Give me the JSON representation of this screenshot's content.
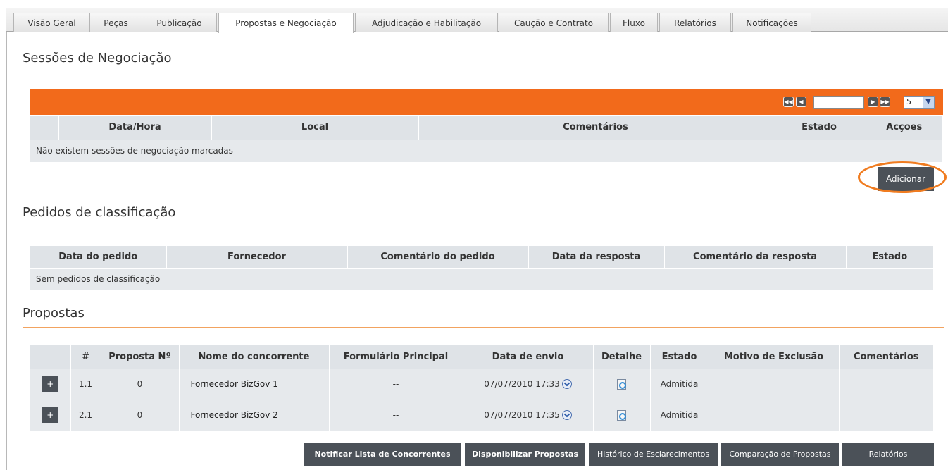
{
  "tabs": [
    {
      "label": "Visão Geral"
    },
    {
      "label": "Peças"
    },
    {
      "label": "Publicação"
    },
    {
      "label": "Propostas e Negociação"
    },
    {
      "label": "Adjudicação e Habilitação"
    },
    {
      "label": "Caução e Contrato"
    },
    {
      "label": "Fluxo"
    },
    {
      "label": "Relatórios"
    },
    {
      "label": "Notificações"
    }
  ],
  "active_tab": "Propostas e Negociação",
  "sessoes": {
    "title": "Sessões de Negociação",
    "pager": {
      "page_size": "5"
    },
    "headers": [
      "Data/Hora",
      "Local",
      "Comentários",
      "Estado",
      "Acções"
    ],
    "empty_message": "Não existem sessões de negociação marcadas",
    "add_button": "Adicionar"
  },
  "pedidos": {
    "title": "Pedidos de classificação",
    "headers": [
      "Data do pedido",
      "Fornecedor",
      "Comentário do pedido",
      "Data da resposta",
      "Comentário da resposta",
      "Estado"
    ],
    "empty_message": "Sem pedidos de classificação"
  },
  "propostas": {
    "title": "Propostas",
    "headers": [
      "#",
      "Proposta Nº",
      "Nome do concorrente",
      "Formulário Principal",
      "Data de envio",
      "Detalhe",
      "Estado",
      "Motivo de Exclusão",
      "Comentários"
    ],
    "rows": [
      {
        "expand": "+",
        "num": "1.1",
        "proposta": "0",
        "nome": "Fornecedor BizGov 1",
        "formulario": "--",
        "data": "07/07/2010 17:33",
        "estado": "Admitida",
        "motivo": "",
        "comentarios": ""
      },
      {
        "expand": "+",
        "num": "2.1",
        "proposta": "0",
        "nome": "Fornecedor BizGov 2",
        "formulario": "--",
        "data": "07/07/2010 17:35",
        "estado": "Admitida",
        "motivo": "",
        "comentarios": ""
      }
    ]
  },
  "bottom_buttons": {
    "notificar": "Notificar Lista de Concorrentes",
    "disponibilizar": "Disponibilizar Propostas",
    "historico": "Histórico de Esclarecimentos",
    "comparacao": "Comparação de Propostas",
    "relatorios": "Relatórios"
  },
  "colors": {
    "accent": "#f26a1b",
    "dark_button": "#4b5158",
    "table_bg": "#e6e9ec"
  }
}
